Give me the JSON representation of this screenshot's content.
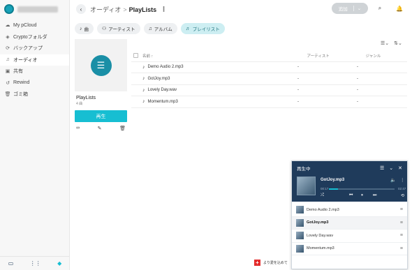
{
  "sidebar": {
    "items": [
      {
        "label": "My pCloud",
        "icon": "cloud-icon"
      },
      {
        "label": "Cryptoフォルダ",
        "icon": "crypto-icon"
      },
      {
        "label": "バックアップ",
        "icon": "backup-icon"
      },
      {
        "label": "オーディオ",
        "icon": "headphones-icon",
        "active": true
      },
      {
        "label": "共有",
        "icon": "shared-icon"
      },
      {
        "label": "Rewind",
        "icon": "rewind-icon"
      },
      {
        "label": "ゴミ箱",
        "icon": "trash-icon"
      }
    ],
    "bottom": [
      "desktop-icon",
      "apps-grid-icon",
      "diamond-icon"
    ]
  },
  "header": {
    "root": "オーディオ",
    "separator": ">",
    "current": "PlayLists",
    "add_label": "追加"
  },
  "chips": [
    {
      "label": "曲",
      "icon": "music-note-icon"
    },
    {
      "label": "アーティスト",
      "icon": "artist-icon"
    },
    {
      "label": "アルバム",
      "icon": "album-icon"
    },
    {
      "label": "プレイリスト",
      "icon": "playlist-icon",
      "active": true
    }
  ],
  "playlist": {
    "title": "PlayLists",
    "count": "4 曲",
    "play_label": "再生"
  },
  "table": {
    "headers": {
      "name": "名前 ↑",
      "artist": "アーティスト",
      "genre": "ジャンル"
    },
    "rows": [
      {
        "name": "Demo Audio 2.mp3",
        "artist": "-",
        "genre": "-"
      },
      {
        "name": "GotJoy.mp3",
        "artist": "-",
        "genre": "-"
      },
      {
        "name": "Lovely Day.wav",
        "artist": "-",
        "genre": "-"
      },
      {
        "name": "Momentum.mp3",
        "artist": "-",
        "genre": "-"
      }
    ]
  },
  "player": {
    "title": "再生中",
    "now_playing": "GotJoy.mp3",
    "time_current": "00:17",
    "time_total": "02:47",
    "progress": 0.14,
    "queue": [
      {
        "name": "Demo Audio 2.mp3"
      },
      {
        "name": "GotJoy.mp3",
        "active": true
      },
      {
        "name": "Lovely Day.wav"
      },
      {
        "name": "Momentum.mp3"
      }
    ]
  },
  "banner": {
    "text": "より愛を込めて"
  },
  "colors": {
    "accent": "#17bed2",
    "player_header": "#1f3b5b",
    "flag": "#e32b2b"
  }
}
